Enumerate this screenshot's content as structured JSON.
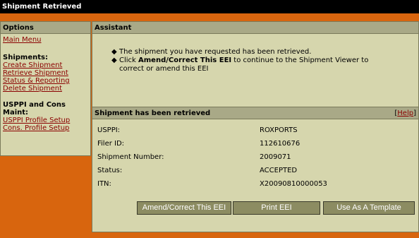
{
  "window": {
    "title": "Shipment Retrieved"
  },
  "options": {
    "title": "Options",
    "main_menu": "Main Menu",
    "shipments_heading": "Shipments:",
    "links": [
      "Create Shipment",
      "Retrieve Shipment",
      "Status & Reporting",
      "Delete Shipment"
    ],
    "usppi_heading_1": "USPPI and Cons",
    "usppi_heading_2": "Maint:",
    "usppi_links": [
      "USPPI Profile Setup",
      "Cons. Profile Setup"
    ]
  },
  "assistant": {
    "title": "Assistant",
    "bullet_1": "The shipment you have requested has been retrieved.",
    "bullet_2_pre": "Click ",
    "bullet_2_bold": "Amend/Correct This EEI",
    "bullet_2_post": " to continue to the Shipment Viewer to",
    "bullet_2_line2": "correct or amend this EEI"
  },
  "retrieved": {
    "title": "Shipment has been retrieved",
    "help": "Help",
    "fields": [
      {
        "label": "USPPI:",
        "value": "ROXPORTS"
      },
      {
        "label": "Filer ID:",
        "value": "112610676"
      },
      {
        "label": "Shipment Number:",
        "value": "2009071"
      },
      {
        "label": "Status:",
        "value": "ACCEPTED"
      },
      {
        "label": "ITN:",
        "value": "X20090810000053"
      }
    ],
    "buttons": {
      "amend": "Amend/Correct This EEI",
      "print": "Print EEI",
      "template": "Use As A Template"
    }
  }
}
